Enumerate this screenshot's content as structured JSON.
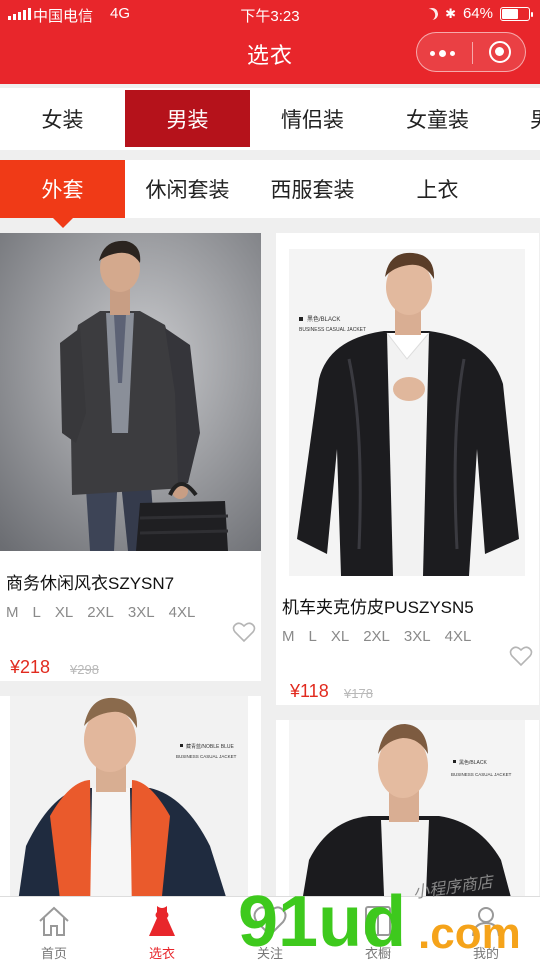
{
  "status": {
    "carrier": "中国电信",
    "network": "4G",
    "time": "下午3:23",
    "battery": "64%",
    "battery_level": 0.64
  },
  "header": {
    "title": "选衣"
  },
  "categories": [
    "女装",
    "男装",
    "情侣装",
    "女童装",
    "男"
  ],
  "category_active": "男装",
  "subcategories": [
    "外套",
    "休闲套装",
    "西服套装",
    "上衣"
  ],
  "subcategory_active": "外套",
  "products": [
    {
      "title": "商务休闲风衣SZYSN7",
      "sizes": [
        "M",
        "L",
        "XL",
        "2XL",
        "3XL",
        "4XL"
      ],
      "price": "¥218",
      "old_price": "¥298"
    },
    {
      "title": "机车夹克仿皮PUSZYSN5",
      "sizes": [
        "M",
        "L",
        "XL",
        "2XL",
        "3XL",
        "4XL"
      ],
      "price": "¥118",
      "old_price": "¥178",
      "photo_tag": "黑色/BLACK",
      "photo_tag_sub": "BUSINESS CASUAL JACKET"
    },
    {
      "title": "",
      "photo_tag": "藏青蓝/NOBLE BLUE",
      "photo_tag_sub": "BUSINESS CASUAL JACKET"
    },
    {
      "title": "",
      "photo_tag": "黑色/BLACK",
      "photo_tag_sub": "BUSINESS CASUAL JACKET"
    }
  ],
  "tabbar": [
    {
      "label": "首页",
      "icon": "home-icon"
    },
    {
      "label": "选衣",
      "icon": "dress-icon"
    },
    {
      "label": "关注",
      "icon": "heart-icon"
    },
    {
      "label": "衣橱",
      "icon": "wardrobe-icon"
    },
    {
      "label": "我的",
      "icon": "user-icon"
    }
  ],
  "watermark": {
    "brand": "91ud",
    "tld": ".com",
    "tagline": "小程序商店"
  },
  "colors": {
    "brand_red": "#e8262b",
    "active_tab": "#b5121b",
    "sub_active": "#f03a17",
    "price": "#e12a1e"
  }
}
